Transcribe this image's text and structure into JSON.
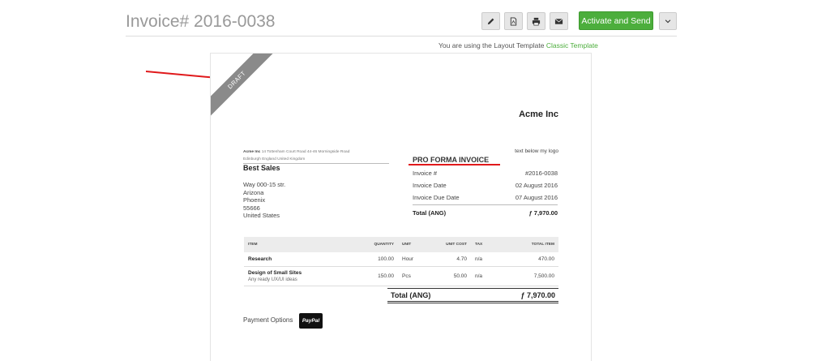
{
  "header": {
    "title": "Invoice# 2016-0038",
    "send_label": "Activate and Send"
  },
  "icons": {
    "edit": "pencil-icon",
    "pdf": "pdf-file-icon",
    "print": "printer-icon",
    "email": "envelope-icon",
    "dropdown": "chevron-down-icon"
  },
  "colors": {
    "accent": "#4cae3c",
    "ribbon": "#8a8a8a",
    "annotation_red": "#e0191b"
  },
  "layout_note": {
    "prefix": "You are using the Layout Template",
    "template_name": "Classic Template"
  },
  "invoice": {
    "status": "DRAFT",
    "company": "Acme Inc",
    "sender_name": "Acme Inc",
    "sender_address_line1": "14 Tottenham Court Road 44-46 Morningside Road",
    "sender_address_line2": "Edinburgh England United Kingdom",
    "logo_text": "text below my logo",
    "client_name": "Best Sales",
    "client_address": {
      "street": "Way 000-15 str.",
      "state": "Arizona",
      "city": "Phoenix",
      "zip": "55666",
      "country": "United States"
    },
    "type_title": "PRO FORMA INVOICE",
    "meta": [
      {
        "label": "Invoice #",
        "value": "#2016-0038"
      },
      {
        "label": "Invoice Date",
        "value": "02 August 2016"
      },
      {
        "label": "Invoice Due Date",
        "value": "07 August 2016"
      }
    ],
    "total_label": "Total (ANG)",
    "total_value": "ƒ 7,970.00",
    "columns": [
      "ITEM",
      "QUANTITY",
      "UNIT",
      "UNIT COST",
      "TAX",
      "TOTAL ITEM"
    ],
    "items": [
      {
        "name": "Research",
        "desc": "",
        "quantity": "100.00",
        "unit": "Hour",
        "unit_cost": "4.70",
        "tax": "n/a",
        "total": "470.00"
      },
      {
        "name": "Design of Small Sites",
        "desc": "Any ready UX/UI ideas",
        "quantity": "150.00",
        "unit": "Pcs",
        "unit_cost": "50.00",
        "tax": "n/a",
        "total": "7,500.00"
      }
    ],
    "grand_total_label": "Total (ANG)",
    "grand_total_value": "ƒ 7,970.00",
    "payment_label": "Payment Options",
    "payment_method": "PayPal"
  }
}
